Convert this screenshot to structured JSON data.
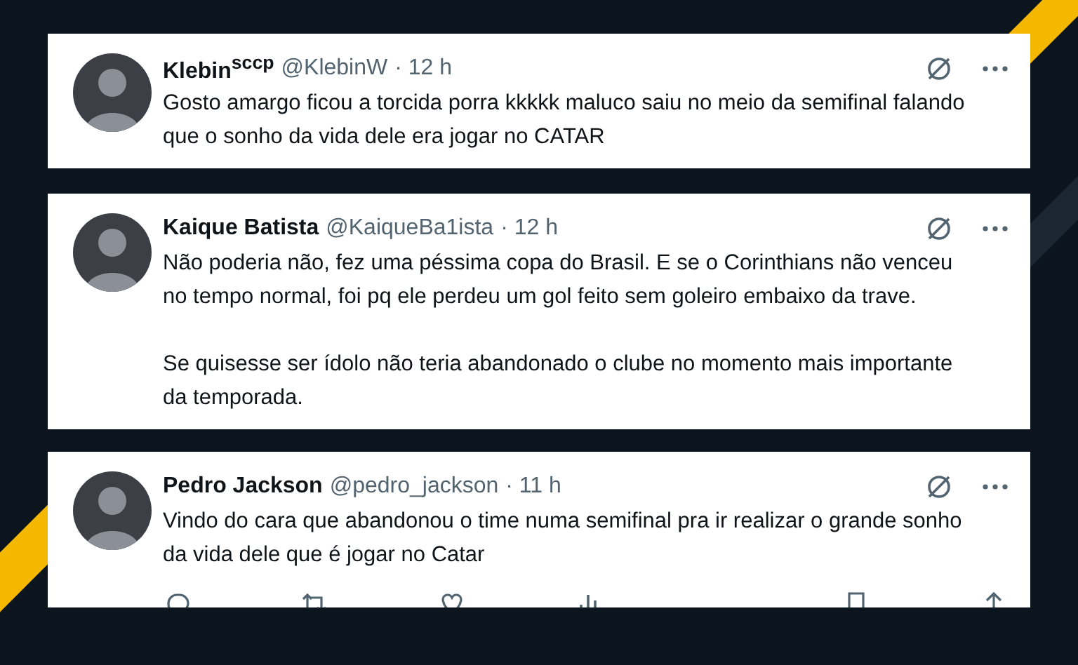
{
  "tweets": [
    {
      "name": "Klebin$^{sccp}$",
      "handle": "@KlebinW",
      "time": "· 12 h",
      "paragraphs": [
        "Gosto amargo ficou a torcida porra kkkkk maluco saiu no meio da semifinal falando que o sonho da vida dele era jogar no CATAR"
      ],
      "actions_visible": false
    },
    {
      "name": "Kaique Batista",
      "handle": "@KaiqueBa1ista",
      "time": "· 12 h",
      "paragraphs": [
        "Não poderia não, fez uma péssima copa do Brasil. E se o Corinthians não venceu no tempo normal, foi pq ele perdeu um gol feito sem goleiro embaixo da trave.",
        "Se quisesse ser ídolo não teria abandonado o clube no momento mais importante da temporada."
      ],
      "actions_visible": false
    },
    {
      "name": "Pedro Jackson",
      "handle": "@pedro_jackson",
      "time": "· 11 h",
      "paragraphs": [
        "Vindo do cara que abandonou o time numa semifinal pra ir realizar o grande sonho da vida dele que é jogar no Catar"
      ],
      "actions_visible": true
    }
  ]
}
